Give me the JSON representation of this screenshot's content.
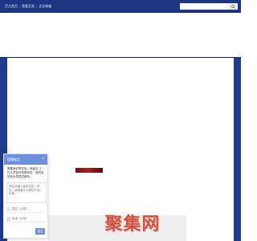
{
  "topnav": {
    "links": [
      "百方首页",
      "我要买卖",
      "企业邮箱"
    ],
    "separators": [
      "|",
      "|"
    ]
  },
  "search": {
    "placeholder": "",
    "icon": "search-icon"
  },
  "watermark": {
    "text": "聚集网"
  },
  "chat": {
    "title": "提醒留言",
    "close_glyph": "×",
    "intro": "需要我们帮您找，请留言,工作人员会尽快联系您，我们会尽快为您提供服务。",
    "textarea_placeholder": "请在此输入留言内容，例如：我想要什么样的产品，价格……",
    "name_placeholder": "姓名（必填）",
    "phone_placeholder": "电话（必填）",
    "submit_label": "提交"
  },
  "colors": {
    "frame": "#1f3a8e",
    "accent": "#6c8fe0",
    "watermark": "#d4503f"
  }
}
